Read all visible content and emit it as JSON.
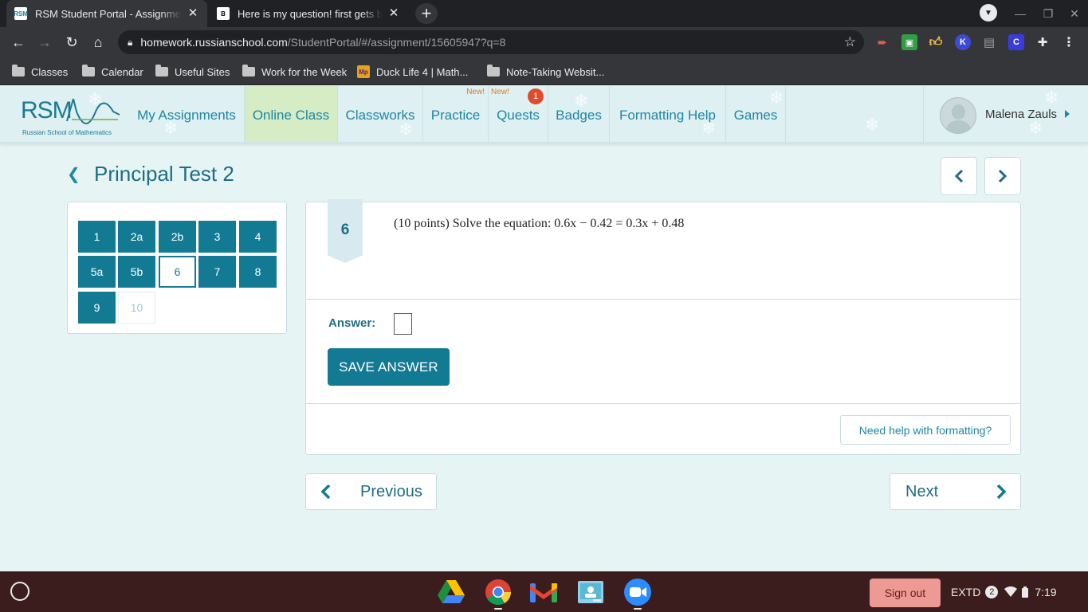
{
  "browser": {
    "tabs": [
      {
        "title": "RSM Student Portal - Assignment",
        "favicon": "RSM",
        "active": true
      },
      {
        "title": "Here is my question! first gets brainliest",
        "favicon": "B",
        "active": false
      }
    ],
    "new_tab": "+",
    "url_host": "homework.russianschool.com",
    "url_path": "/StudentPortal/#/assignment/15605947?q=8",
    "bookmarks": [
      {
        "label": "Classes",
        "icon": "folder-icon"
      },
      {
        "label": "Calendar",
        "icon": "folder-icon"
      },
      {
        "label": "Useful Sites",
        "icon": "folder-icon"
      },
      {
        "label": "Work for the Week",
        "icon": "folder-icon"
      },
      {
        "label": "Duck Life 4 | Math...",
        "icon": "math-playground-icon"
      },
      {
        "label": "Note-Taking Websit...",
        "icon": "folder-icon"
      }
    ]
  },
  "header": {
    "logo_text": "RSM",
    "logo_subtitle": "Russian School of Mathematics",
    "nav": [
      {
        "label": "My Assignments"
      },
      {
        "label": "Online Class"
      },
      {
        "label": "Classworks"
      },
      {
        "label": "Practice",
        "new": "New!"
      },
      {
        "label": "Quests",
        "new": "New!",
        "badge": "1"
      },
      {
        "label": "Badges"
      },
      {
        "label": "Formatting Help"
      },
      {
        "label": "Games"
      }
    ],
    "user_name": "Malena Zauls"
  },
  "assignment": {
    "title": "Principal Test 2",
    "questions": [
      "1",
      "2a",
      "2b",
      "3",
      "4",
      "5a",
      "5b",
      "6",
      "7",
      "8",
      "9",
      "10"
    ],
    "current_question": "6",
    "question_number": "6",
    "question_text": "(10 points) Solve the equation: 0.6x − 0.42 = 0.3x + 0.48",
    "answer_label": "Answer:",
    "save_button": "SAVE ANSWER",
    "help_button": "Need help with formatting?",
    "previous_button": "Previous",
    "next_button": "Next"
  },
  "shelf": {
    "apps": [
      "google-drive-icon",
      "chrome-icon",
      "gmail-icon",
      "classroom-icon",
      "zoom-icon"
    ],
    "sign_out": "Sign out",
    "keyboard": "EXTD",
    "notification_count": "2",
    "time": "7:19"
  },
  "colors": {
    "brand": "#137a94",
    "nav_text": "#1d87a5",
    "active_nav_bg": "#d6ecc4",
    "page_bg": "#e6f5f3",
    "badge_red": "#e04c2b"
  }
}
